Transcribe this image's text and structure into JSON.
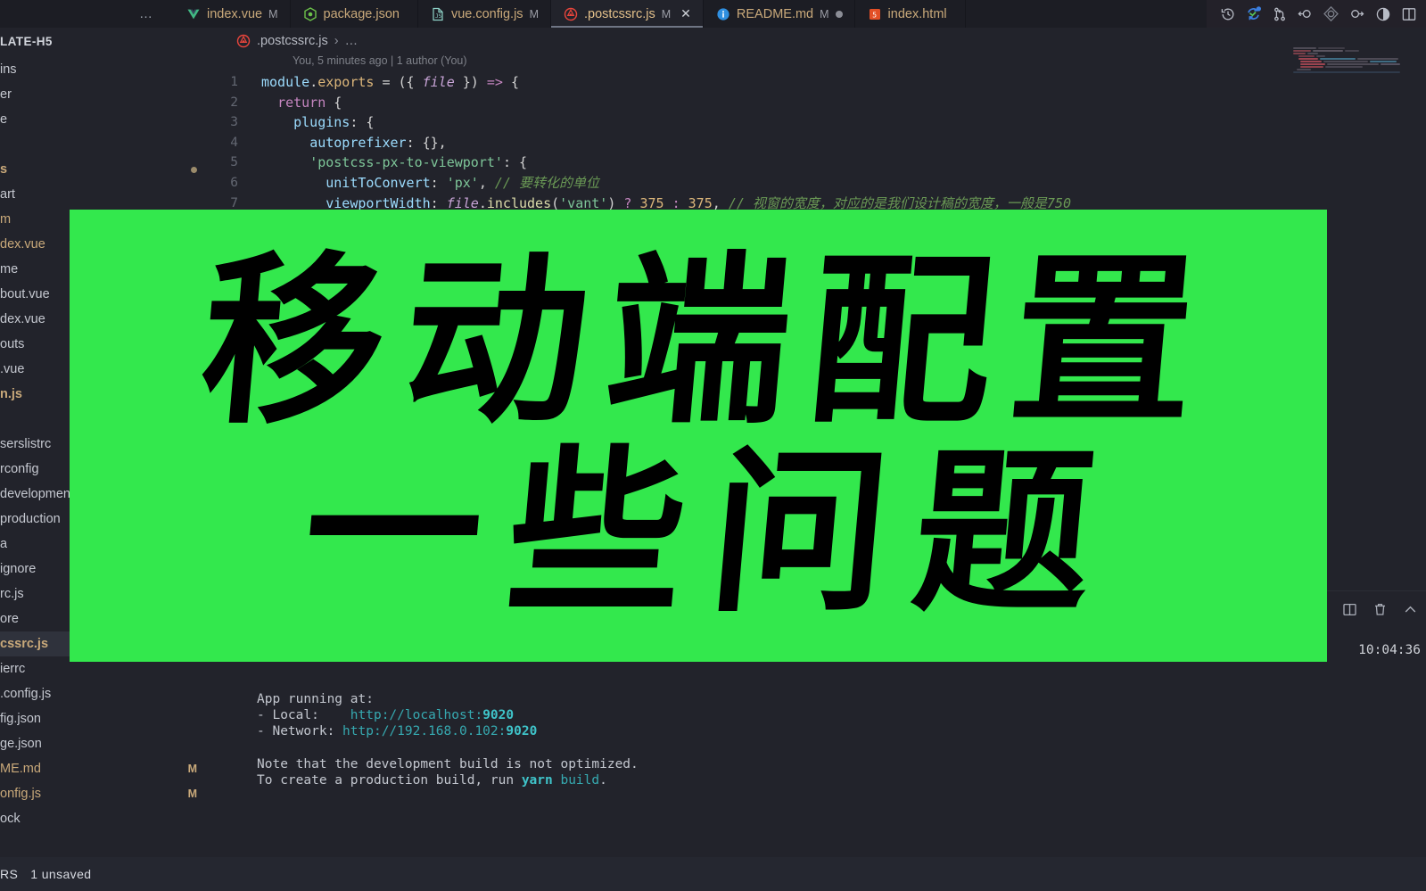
{
  "window": {
    "title": "VS Code",
    "overflow_menu": "…"
  },
  "tabs": [
    {
      "label": "index.vue",
      "icon": "vue-icon",
      "modified_flag": "M",
      "active": false,
      "dirty_dot": false,
      "closable": false
    },
    {
      "label": "package.json",
      "icon": "nodejs-icon",
      "modified_flag": "",
      "active": false,
      "dirty_dot": false,
      "closable": false
    },
    {
      "label": "vue.config.js",
      "icon": "js-file-icon",
      "modified_flag": "M",
      "active": false,
      "dirty_dot": false,
      "closable": false
    },
    {
      "label": ".postcssrc.js",
      "icon": "postcss-icon",
      "modified_flag": "M",
      "active": true,
      "dirty_dot": false,
      "closable": true,
      "close_glyph": "✕"
    },
    {
      "label": "README.md",
      "icon": "info-icon",
      "modified_flag": "M",
      "active": false,
      "dirty_dot": true,
      "closable": false
    },
    {
      "label": "index.html",
      "icon": "html5-icon",
      "modified_flag": "",
      "active": false,
      "dirty_dot": false,
      "closable": false
    }
  ],
  "tab_actions": [
    {
      "name": "timeline-history-icon",
      "title": "History"
    },
    {
      "name": "sync-changes-icon",
      "title": "Sync Changes",
      "active": true
    },
    {
      "name": "source-control-icon",
      "title": "Source Control"
    },
    {
      "name": "previous-change-icon",
      "title": "Previous Change"
    },
    {
      "name": "current-change-icon",
      "title": "Current Change"
    },
    {
      "name": "next-change-icon",
      "title": "Next Change"
    },
    {
      "name": "toggle-inline-view-icon",
      "title": "Toggle Inline View"
    },
    {
      "name": "split-editor-icon",
      "title": "Split Editor"
    }
  ],
  "sidebar": {
    "title": "LATE-H5",
    "items": [
      {
        "label": "ins",
        "indent": 0,
        "modified": false,
        "selected": false,
        "bold": false
      },
      {
        "label": "er",
        "indent": 0,
        "modified": false,
        "selected": false,
        "bold": false
      },
      {
        "label": "e",
        "indent": 0,
        "modified": false,
        "selected": false,
        "bold": false
      },
      {
        "label": "",
        "indent": 0,
        "modified": false,
        "selected": false,
        "bold": false
      },
      {
        "label": "s",
        "indent": 0,
        "modified": true,
        "selected": false,
        "bold": true,
        "trailing_dot": true
      },
      {
        "label": "art",
        "indent": 0,
        "modified": false,
        "selected": false,
        "bold": false
      },
      {
        "label": "m",
        "indent": 0,
        "modified": true,
        "selected": false,
        "bold": false
      },
      {
        "label": "dex.vue",
        "indent": 0,
        "modified": true,
        "selected": false,
        "bold": false
      },
      {
        "label": "me",
        "indent": 0,
        "modified": false,
        "selected": false,
        "bold": false
      },
      {
        "label": "bout.vue",
        "indent": 0,
        "modified": false,
        "selected": false,
        "bold": false
      },
      {
        "label": "dex.vue",
        "indent": 0,
        "modified": false,
        "selected": false,
        "bold": false
      },
      {
        "label": "outs",
        "indent": 0,
        "modified": false,
        "selected": false,
        "bold": false
      },
      {
        "label": ".vue",
        "indent": 0,
        "modified": false,
        "selected": false,
        "bold": false
      },
      {
        "label": "n.js",
        "indent": 0,
        "modified": true,
        "selected": false,
        "bold": true
      },
      {
        "label": "",
        "indent": 0,
        "modified": false,
        "selected": false,
        "bold": false
      },
      {
        "label": "serslistrc",
        "indent": 0,
        "modified": false,
        "selected": false,
        "bold": false
      },
      {
        "label": "rconfig",
        "indent": 0,
        "modified": false,
        "selected": false,
        "bold": false
      },
      {
        "label": "developmen",
        "indent": 0,
        "modified": false,
        "selected": false,
        "bold": false
      },
      {
        "label": "production",
        "indent": 0,
        "modified": false,
        "selected": false,
        "bold": false
      },
      {
        "label": "a",
        "indent": 0,
        "modified": false,
        "selected": false,
        "bold": false
      },
      {
        "label": "ignore",
        "indent": 0,
        "modified": false,
        "selected": false,
        "bold": false
      },
      {
        "label": "rc.js",
        "indent": 0,
        "modified": false,
        "selected": false,
        "bold": false
      },
      {
        "label": "ore",
        "indent": 0,
        "modified": false,
        "selected": false,
        "bold": false
      },
      {
        "label": "cssrc.js",
        "indent": 0,
        "modified": true,
        "selected": true,
        "bold": true
      },
      {
        "label": "ierrc",
        "indent": 0,
        "modified": false,
        "selected": false,
        "bold": false
      },
      {
        "label": ".config.js",
        "indent": 0,
        "modified": false,
        "selected": false,
        "bold": false
      },
      {
        "label": "fig.json",
        "indent": 0,
        "modified": false,
        "selected": false,
        "bold": false
      },
      {
        "label": "ge.json",
        "indent": 0,
        "modified": false,
        "selected": false,
        "bold": false
      },
      {
        "label": "ME.md",
        "indent": 0,
        "modified": true,
        "selected": false,
        "bold": false,
        "status": "M"
      },
      {
        "label": "onfig.js",
        "indent": 0,
        "modified": true,
        "selected": false,
        "bold": false,
        "status": "M"
      },
      {
        "label": "ock",
        "indent": 0,
        "modified": false,
        "selected": false,
        "bold": false
      }
    ]
  },
  "breadcrumb": {
    "file": ".postcssrc.js",
    "separator": "›",
    "rest": "…"
  },
  "editor": {
    "blame": "You, 5 minutes ago | 1 author (You)",
    "line_numbers": [
      "1",
      "2",
      "3",
      "4",
      "5",
      "6",
      "7"
    ],
    "lines": [
      "module.exports = ({ file }) => {",
      "  return {",
      "    plugins: {",
      "      autoprefixer: {},",
      "      'postcss-px-to-viewport': {",
      "        unitToConvert: 'px', // 要转化的单位",
      "        viewportWidth: file.includes('vant') ? 375 : 375, // 视窗的宽度，对应的是我们设计稿的宽度，一般是750"
    ],
    "tokens": {
      "l1": [
        "module",
        ".",
        "exports",
        " = ",
        "({ ",
        "file",
        " }) ",
        "=>",
        " {"
      ],
      "l2_return": "return",
      "l3_plugins": "plugins",
      "l4_autoprefixer": "autoprefixer",
      "l5_pxtoviewport": "'postcss-px-to-viewport'",
      "l6_key": "unitToConvert",
      "l6_val": "'px'",
      "l6_comment": "// 要转化的单位",
      "l7_key": "viewportWidth",
      "l7_file": "file",
      "l7_includes": "includes",
      "l7_arg": "'vant'",
      "l7_num1": "375",
      "l7_num2": "375",
      "l7_comment": "// 视窗的宽度，对应的是我们设计稿的宽度，一般是750"
    }
  },
  "panel": {
    "actions": [
      {
        "name": "split-terminal-icon",
        "title": "Split Terminal"
      },
      {
        "name": "kill-terminal-icon",
        "title": "Kill Terminal"
      },
      {
        "name": "maximize-panel-icon",
        "title": "Maximize Panel"
      }
    ],
    "clock": "10:04:36",
    "terminal": {
      "header": "App running at:",
      "local_label": "- Local:  ",
      "local_url": "http://localhost:",
      "local_port": "9020",
      "network_label": "- Network:",
      "network_url": " http://192.168.0.102:",
      "network_port": "9020",
      "note1": "Note that the development build is not optimized.",
      "note2_a": "To create a production build, run ",
      "note2_yarn": "yarn",
      "note2_build": " build",
      "note2_b": "."
    }
  },
  "overlay": {
    "line1": "移动端配置",
    "line2": "一些问题",
    "bg_color": "#33E84D",
    "text_color": "#000000"
  },
  "statusbar": {
    "editors_label": "RS",
    "unsaved_label": "1 unsaved"
  },
  "colors": {
    "accent_green": "#33E84D",
    "tab_active_text": "#E3C08A",
    "editor_bg": "#22232B",
    "tabbar_bg": "#1C1D24",
    "sidebar_bg": "#22232B",
    "statusbar_bg": "#252730",
    "terminal_cyan": "#3FC3C9"
  }
}
